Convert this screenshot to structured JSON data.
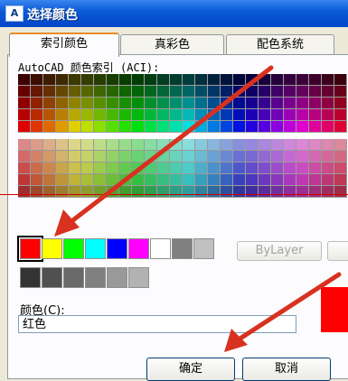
{
  "window": {
    "title": "选择颜色",
    "icon": "autocad-app-icon"
  },
  "tabs": [
    {
      "label": "索引颜色",
      "active": true
    },
    {
      "label": "真彩色",
      "active": false
    },
    {
      "label": "配色系统",
      "active": false
    }
  ],
  "aci_label": "AutoCAD 颜色索引 (ACI):",
  "standard_colors": [
    "#ff0000",
    "#ffff00",
    "#00ff00",
    "#00ffff",
    "#0000ff",
    "#ff00ff",
    "#ffffff",
    "#808080",
    "#c0c0c0"
  ],
  "selected_color_index": 0,
  "gray_colors": [
    "#333333",
    "#505050",
    "#696969",
    "#808080",
    "#999999",
    "#b2b2b2",
    "#cccccc",
    "#e5e5e5",
    "#ffffff"
  ],
  "bylayer_label": "ByLayer",
  "color_label": "颜色(C):",
  "color_value": "红色",
  "preview_color": "#ff0000",
  "buttons": {
    "ok": "确定",
    "cancel": "取消"
  },
  "annotation_color": "#d8311f"
}
